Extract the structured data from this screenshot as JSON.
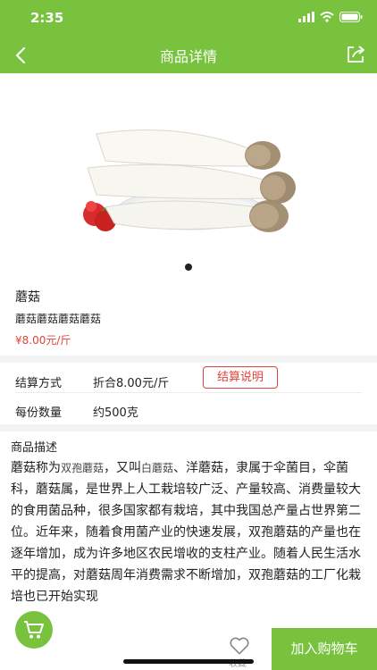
{
  "status_bar": {
    "time": "2:35"
  },
  "nav": {
    "title": "商品详情"
  },
  "gallery": {
    "page_count": 1,
    "active_index": 0
  },
  "product": {
    "name": "蘑菇",
    "subtitle": "蘑菇蘑菇蘑菇蘑菇",
    "price": "¥8.00元/斤"
  },
  "specs": [
    {
      "label": "结算方式",
      "value": "折合8.00元/斤",
      "button": "结算说明"
    },
    {
      "label": "每份数量",
      "value": "约500克"
    }
  ],
  "description": {
    "title": "商品描述",
    "p1": "蘑菇称为",
    "h1": "双孢蘑菇",
    "p2": "，又叫",
    "h2": "白蘑菇",
    "p3": "、洋蘑菇，隶属于伞菌目，伞菌科，蘑菇属，是世界上人工栽培较广泛、产量较高、消费量较大的食用菌品种，很多国家都有栽培，其中我国总产量占世界第二位。近年来，随着食用菌产业的快速发展，双孢蘑菇的产量也在逐年增加，成为许多地区农民增收的支柱产业。随着人民生活水平的提高，对蘑菇周年消费需求不断增加，双孢蘑菇的工厂化栽培也已开始实现"
  },
  "bottom_bar": {
    "favorite_label": "收藏",
    "add_to_cart": "加入购物车"
  },
  "colors": {
    "brand_green": "#78c23e",
    "price_red": "#e0433a"
  }
}
